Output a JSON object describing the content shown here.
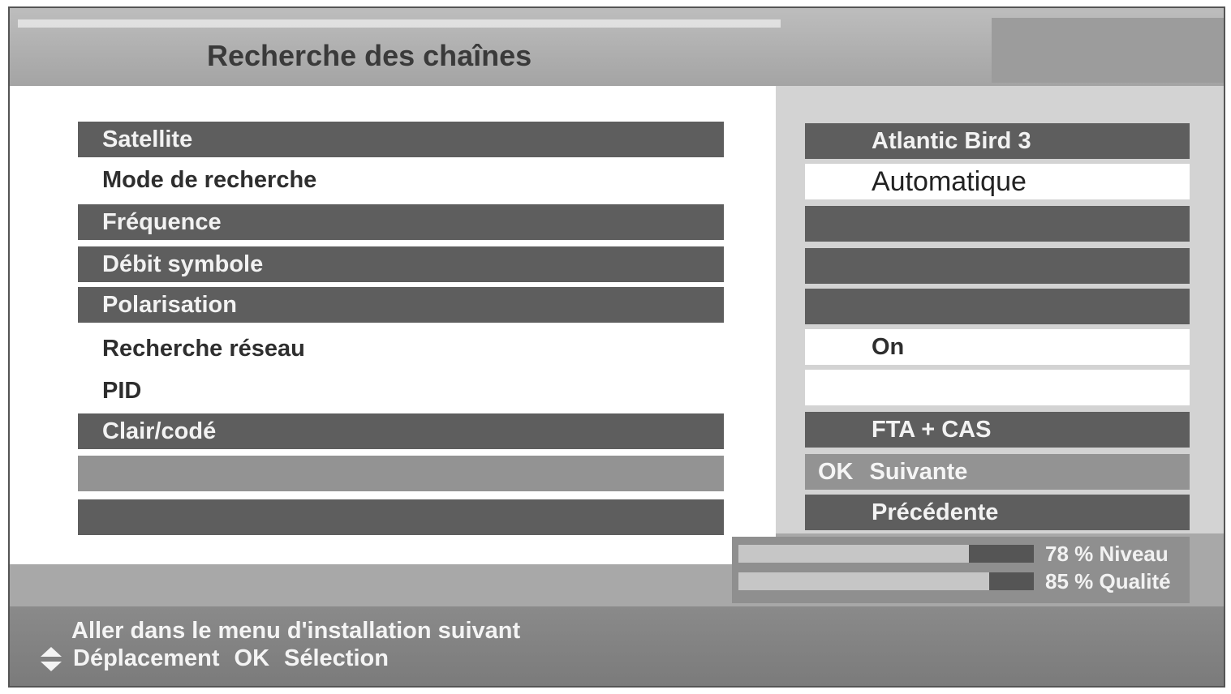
{
  "screen": {
    "title": "Recherche des chaînes"
  },
  "settings": [
    {
      "label": "Satellite",
      "value": "Atlantic Bird 3"
    },
    {
      "label": "Mode de recherche",
      "value": "Automatique"
    },
    {
      "label": "Fréquence",
      "value": ""
    },
    {
      "label": "Débit symbole",
      "value": ""
    },
    {
      "label": "Polarisation",
      "value": ""
    },
    {
      "label": "Recherche réseau",
      "value": "On"
    },
    {
      "label": "PID",
      "value": ""
    },
    {
      "label": "Clair/codé",
      "value": "FTA + CAS"
    }
  ],
  "actions": {
    "next": {
      "key": "OK",
      "label": "Suivante"
    },
    "previous": {
      "label": "Précédente"
    }
  },
  "signal": {
    "level": {
      "percent": 78,
      "text": "78 % Niveau"
    },
    "quality": {
      "percent": 85,
      "text": "85 % Qualité"
    }
  },
  "help": {
    "line1": "Aller dans le menu d'installation suivant",
    "move_label": "Déplacement",
    "ok_key": "OK",
    "select_label": "Sélection"
  },
  "colors": {
    "row_dark": "#5e5e5e",
    "row_highlight": "#939393",
    "panel_bg": "#a8a8a8",
    "text_light": "#f2f2f2",
    "text_dark": "#2e2e2e"
  }
}
